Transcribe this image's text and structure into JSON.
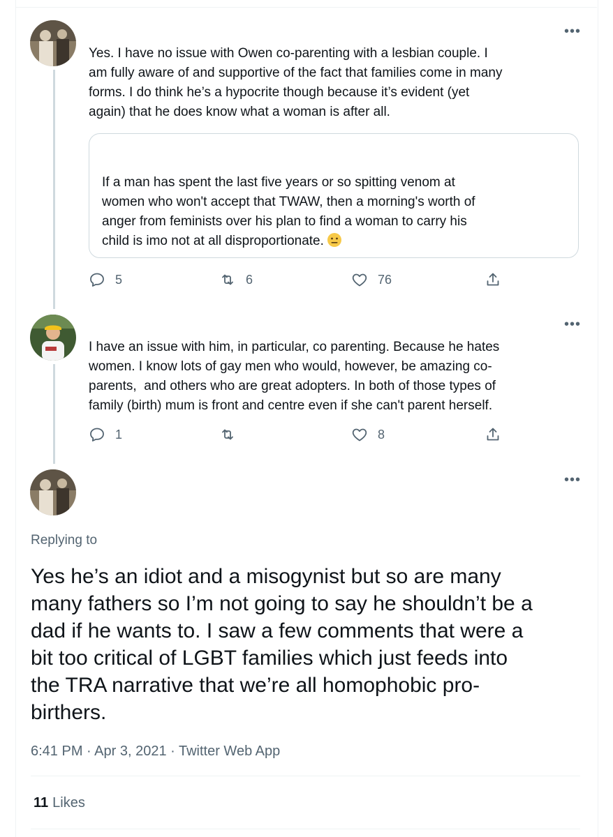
{
  "tweets": [
    {
      "text": "Yes. I have no issue with Owen co-parenting with a lesbian couple. I\nam fully aware of and supportive of the fact that families come in many\nforms. I do think he’s a hypocrite though because it’s evident (yet\nagain) that he does know what a woman is after all.",
      "quote": "If a man has spent the last five years or so spitting venom at\nwomen who won't accept that TWAW, then a morning's worth of\nanger from feminists over his plan to find a woman to carry his\nchild is imo not at all disproportionate.",
      "quote_emoji": "neutral-face-emoji",
      "replies": "5",
      "retweets": "6",
      "likes": "76"
    },
    {
      "text": "I have an issue with him, in particular, co parenting. Because he hates\nwomen. I know lots of gay men who would, however, be amazing co-\nparents,  and others who are great adopters. In both of those types of\nfamily (birth) mum is front and centre even if she can't parent herself.",
      "replies": "1",
      "retweets": "",
      "likes": "8"
    }
  ],
  "main_tweet": {
    "replying_to": "Replying to",
    "text": "Yes he’s an idiot and a misogynist but so are many\nmany fathers so I’m not going to say he shouldn’t be a\ndad if he wants to. I saw a few comments that were a\nbit too critical of LGBT families which just feeds into\nthe TRA narrative that we’re all homophobic pro-\nbirthers.",
    "timestamp": "6:41 PM · Apr 3, 2021 · Twitter Web App",
    "likes_count": "11",
    "likes_label": "Likes"
  },
  "more_label": "•••",
  "colors": {
    "text": "#0f1419",
    "secondary": "#536471",
    "border": "#cfd9de"
  }
}
